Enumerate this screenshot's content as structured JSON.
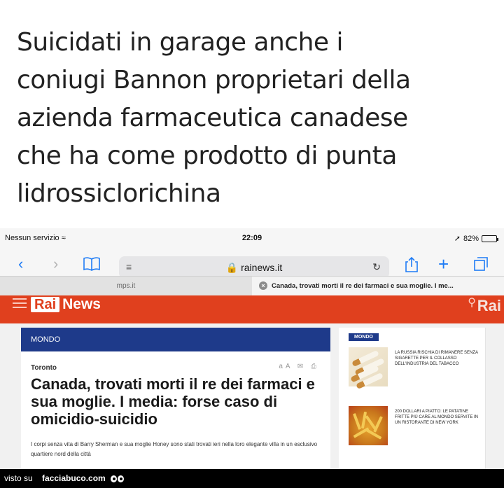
{
  "headline": {
    "lines": [
      "Suicidati in garage anche i",
      "coniugi Bannon proprietari della",
      "azienda farmaceutica canadese",
      "che ha come prodotto di punta",
      "lidrossiclorichina"
    ]
  },
  "statusbar": {
    "carrier": "Nessun servizio",
    "time": "22:09",
    "battery": "82%",
    "battery_level": 0.82
  },
  "browser": {
    "url": "rainews.it",
    "tabs": [
      "mps.it",
      "Canada, trovati morti il re dei farmaci e sua moglie. I me..."
    ]
  },
  "site": {
    "logo_rai": "Rai",
    "logo_news": "News",
    "logo_right": "Rai"
  },
  "article": {
    "section": "MONDO",
    "place": "Toronto",
    "title": "Canada, trovati morti il re dei farmaci e sua moglie. I media: forse caso di omicidio-suicidio",
    "summary": "I corpi senza vita di Barry Sherman e sua moglie Honey sono stati trovati ieri nella loro elegante villa in un esclusivo quartiere nord della città"
  },
  "sidebar": {
    "badge": "MONDO",
    "items": [
      {
        "text": "LA RUSSIA RISCHIA DI RIMANERE SENZA SIGARETTE PER IL COLLASSO DELL'INDUSTRIA DEL TABACCO"
      },
      {
        "text": "200 DOLLARI A PIATTO: LE PATATINE FRITTE PIÙ CARE AL MONDO SERVITE IN UN RISTORANTE DI NEW YORK"
      }
    ]
  },
  "footer": {
    "prefix": "visto su",
    "brand": "facciabuco.com"
  }
}
